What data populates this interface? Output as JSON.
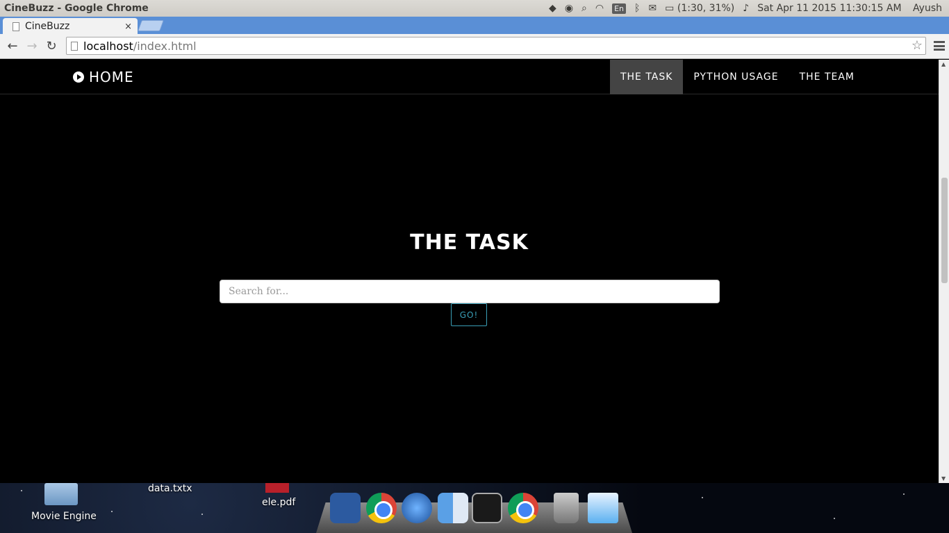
{
  "os": {
    "window_title": "CineBuzz - Google Chrome",
    "input_lang": "En",
    "battery": "(1:30, 31%)",
    "clock": "Sat Apr 11 2015 11:30:15 AM",
    "user": "Ayush"
  },
  "browser": {
    "tab_title": "CineBuzz",
    "tab_close": "×",
    "url_host": "localhost",
    "url_path": "/index.html",
    "back": "←",
    "forward": "→",
    "reload": "↻",
    "star": "☆"
  },
  "site": {
    "brand": "HOME",
    "nav": [
      {
        "label": "THE TASK",
        "active": true
      },
      {
        "label": "PYTHON USAGE",
        "active": false
      },
      {
        "label": "THE TEAM",
        "active": false
      }
    ],
    "hero_title": "THE TASK",
    "search_placeholder": "Search for...",
    "go_label": "GO!"
  },
  "desktop": {
    "items": [
      "Movie Engine",
      "data.txtx",
      "ele.pdf"
    ]
  },
  "colors": {
    "accent": "#3aa0b8",
    "active_nav": "#444444",
    "tab_strip": "#5a8fd6"
  }
}
